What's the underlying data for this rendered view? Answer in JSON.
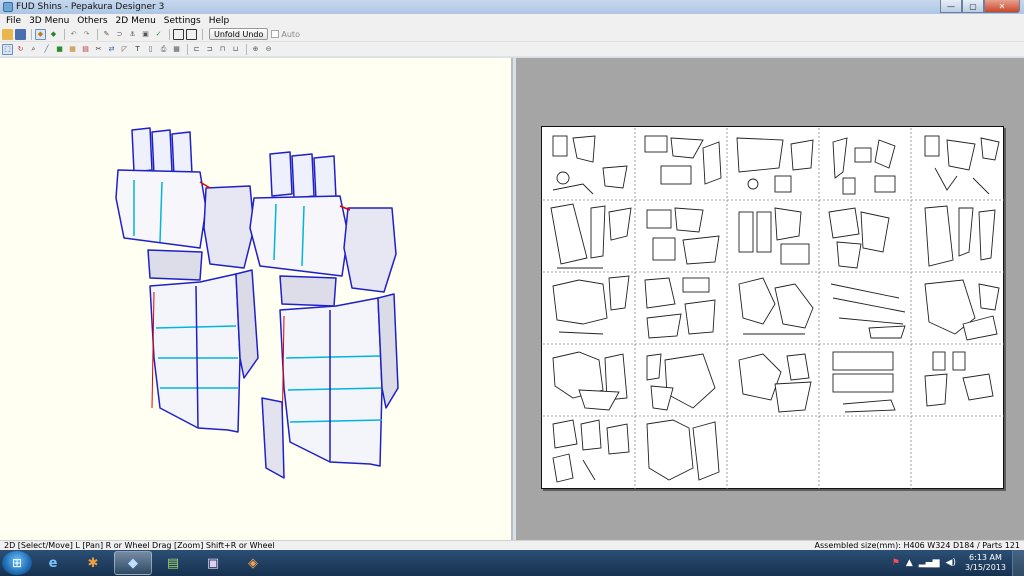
{
  "window": {
    "title": "FUD Shins - Pepakura Designer 3",
    "controls": {
      "minimize": "—",
      "maximize": "▢",
      "close": "✕"
    }
  },
  "menu": [
    "File",
    "3D Menu",
    "Others",
    "2D Menu",
    "Settings",
    "Help"
  ],
  "toolbar1": {
    "icons": [
      "open-icon",
      "save-icon",
      "cube-view-icon",
      "texture-icon",
      "undo-icon",
      "redo-icon",
      "pencil-icon",
      "join-icon",
      "anchor-icon",
      "move-parts-icon",
      "check-icon",
      "view-3d-icon",
      "view-2d-icon"
    ],
    "unfold_undo_label": "Unfold Undo",
    "auto_label": "Auto"
  },
  "toolbar2": {
    "icons": [
      "select-icon",
      "rotate-icon",
      "zoom-icon",
      "edge-icon",
      "part-icon",
      "fold-icon",
      "face-icon",
      "cut-icon",
      "join-edge-icon",
      "flap-icon",
      "text-icon",
      "page-icon",
      "print-icon",
      "grid-icon",
      "align-left-icon",
      "align-right-icon",
      "align-top-icon",
      "align-bottom-icon",
      "zoom-in-icon",
      "zoom-out-icon"
    ]
  },
  "status": {
    "left": "2D [Select/Move] L [Pan] R or Wheel Drag [Zoom] Shift+R or Wheel",
    "right": "Assembled size(mm): H406 W324 D184 / Parts 121"
  },
  "taskbar": {
    "apps": [
      "ie-icon",
      "blender-icon",
      "pepakura-icon",
      "notepad-icon",
      "media-icon",
      "paint-icon"
    ],
    "active_index": 2,
    "time": "6:13 AM",
    "date": "3/15/2013"
  },
  "colors": {
    "viewport_bg": "#fffff2",
    "paper_area_bg": "#a5a5a5",
    "model_edge": "#2020c8",
    "model_highlight": "#e00000",
    "model_fold": "#00b5e0"
  }
}
